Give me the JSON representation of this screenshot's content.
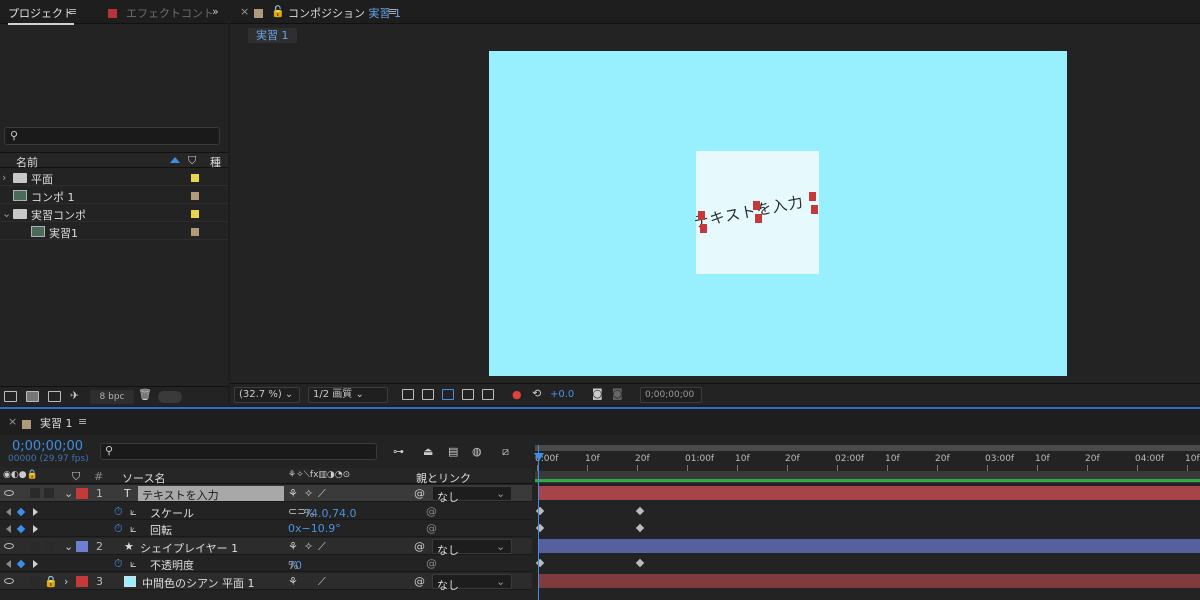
{
  "project_panel": {
    "tab_project": "プロジェクト",
    "tab_effects": "エフェクトコント",
    "col_name": "名前",
    "col_type": "種",
    "items": [
      {
        "name": "平面",
        "kind": "folder",
        "label_color": "#e8d44d",
        "expanded": false
      },
      {
        "name": "コンポ 1",
        "kind": "comp",
        "label_color": "#b09a7a",
        "expanded": false
      },
      {
        "name": "実習コンポ",
        "kind": "folder",
        "label_color": "#e8d44d",
        "expanded": true
      },
      {
        "name": "実習1",
        "kind": "comp",
        "label_color": "#b09a7a",
        "child": true
      }
    ],
    "bpc": "8 bpc"
  },
  "viewer": {
    "tab_prefix": "コンポジション",
    "comp_name": "実習 1",
    "comp_tag": "実習 1",
    "canvas_color": "#98f0fe",
    "solid_color": "#e6fafe",
    "text_layer": "テキストを入力",
    "zoom": "(32.7 %)",
    "resolution": "1/2 画質",
    "exposure": "+0.0",
    "timecode": "0;00;00;00"
  },
  "timeline": {
    "tab_name": "実習 1",
    "timecode": "0;00;00;00",
    "fps": "00000 (29.97 fps)",
    "col_source": "ソース名",
    "col_parent": "親とリンク",
    "ruler_labels": [
      "0:00f",
      "10f",
      "20f",
      "01:00f",
      "10f",
      "20f",
      "02:00f",
      "10f",
      "20f",
      "03:00f",
      "10f",
      "20f",
      "04:00f",
      "10f"
    ],
    "layers": [
      {
        "num": "1",
        "type_icon": "T",
        "name": "テキストを入力",
        "color": "#c43a3a",
        "parent": "なし",
        "bar_color": "#a7434a",
        "selected": true
      },
      {
        "prop": "スケール",
        "value": "74.0,74.0",
        "unit": "%",
        "keyframes": true
      },
      {
        "prop": "回転",
        "value": "0x−10.9°",
        "keyframes": true
      },
      {
        "num": "2",
        "type_icon": "★",
        "name": "シェイプレイヤー 1",
        "color": "#6c7fd0",
        "parent": "なし",
        "bar_color": "#5560a0"
      },
      {
        "prop": "不透明度",
        "value": "70",
        "unit": "%",
        "keyframes": true
      },
      {
        "num": "3",
        "type_icon": "solid",
        "name": "中間色のシアン 平面 1",
        "color": "#c43a3a",
        "parent": "なし",
        "bar_color": "#803c3c",
        "locked": true
      }
    ]
  }
}
